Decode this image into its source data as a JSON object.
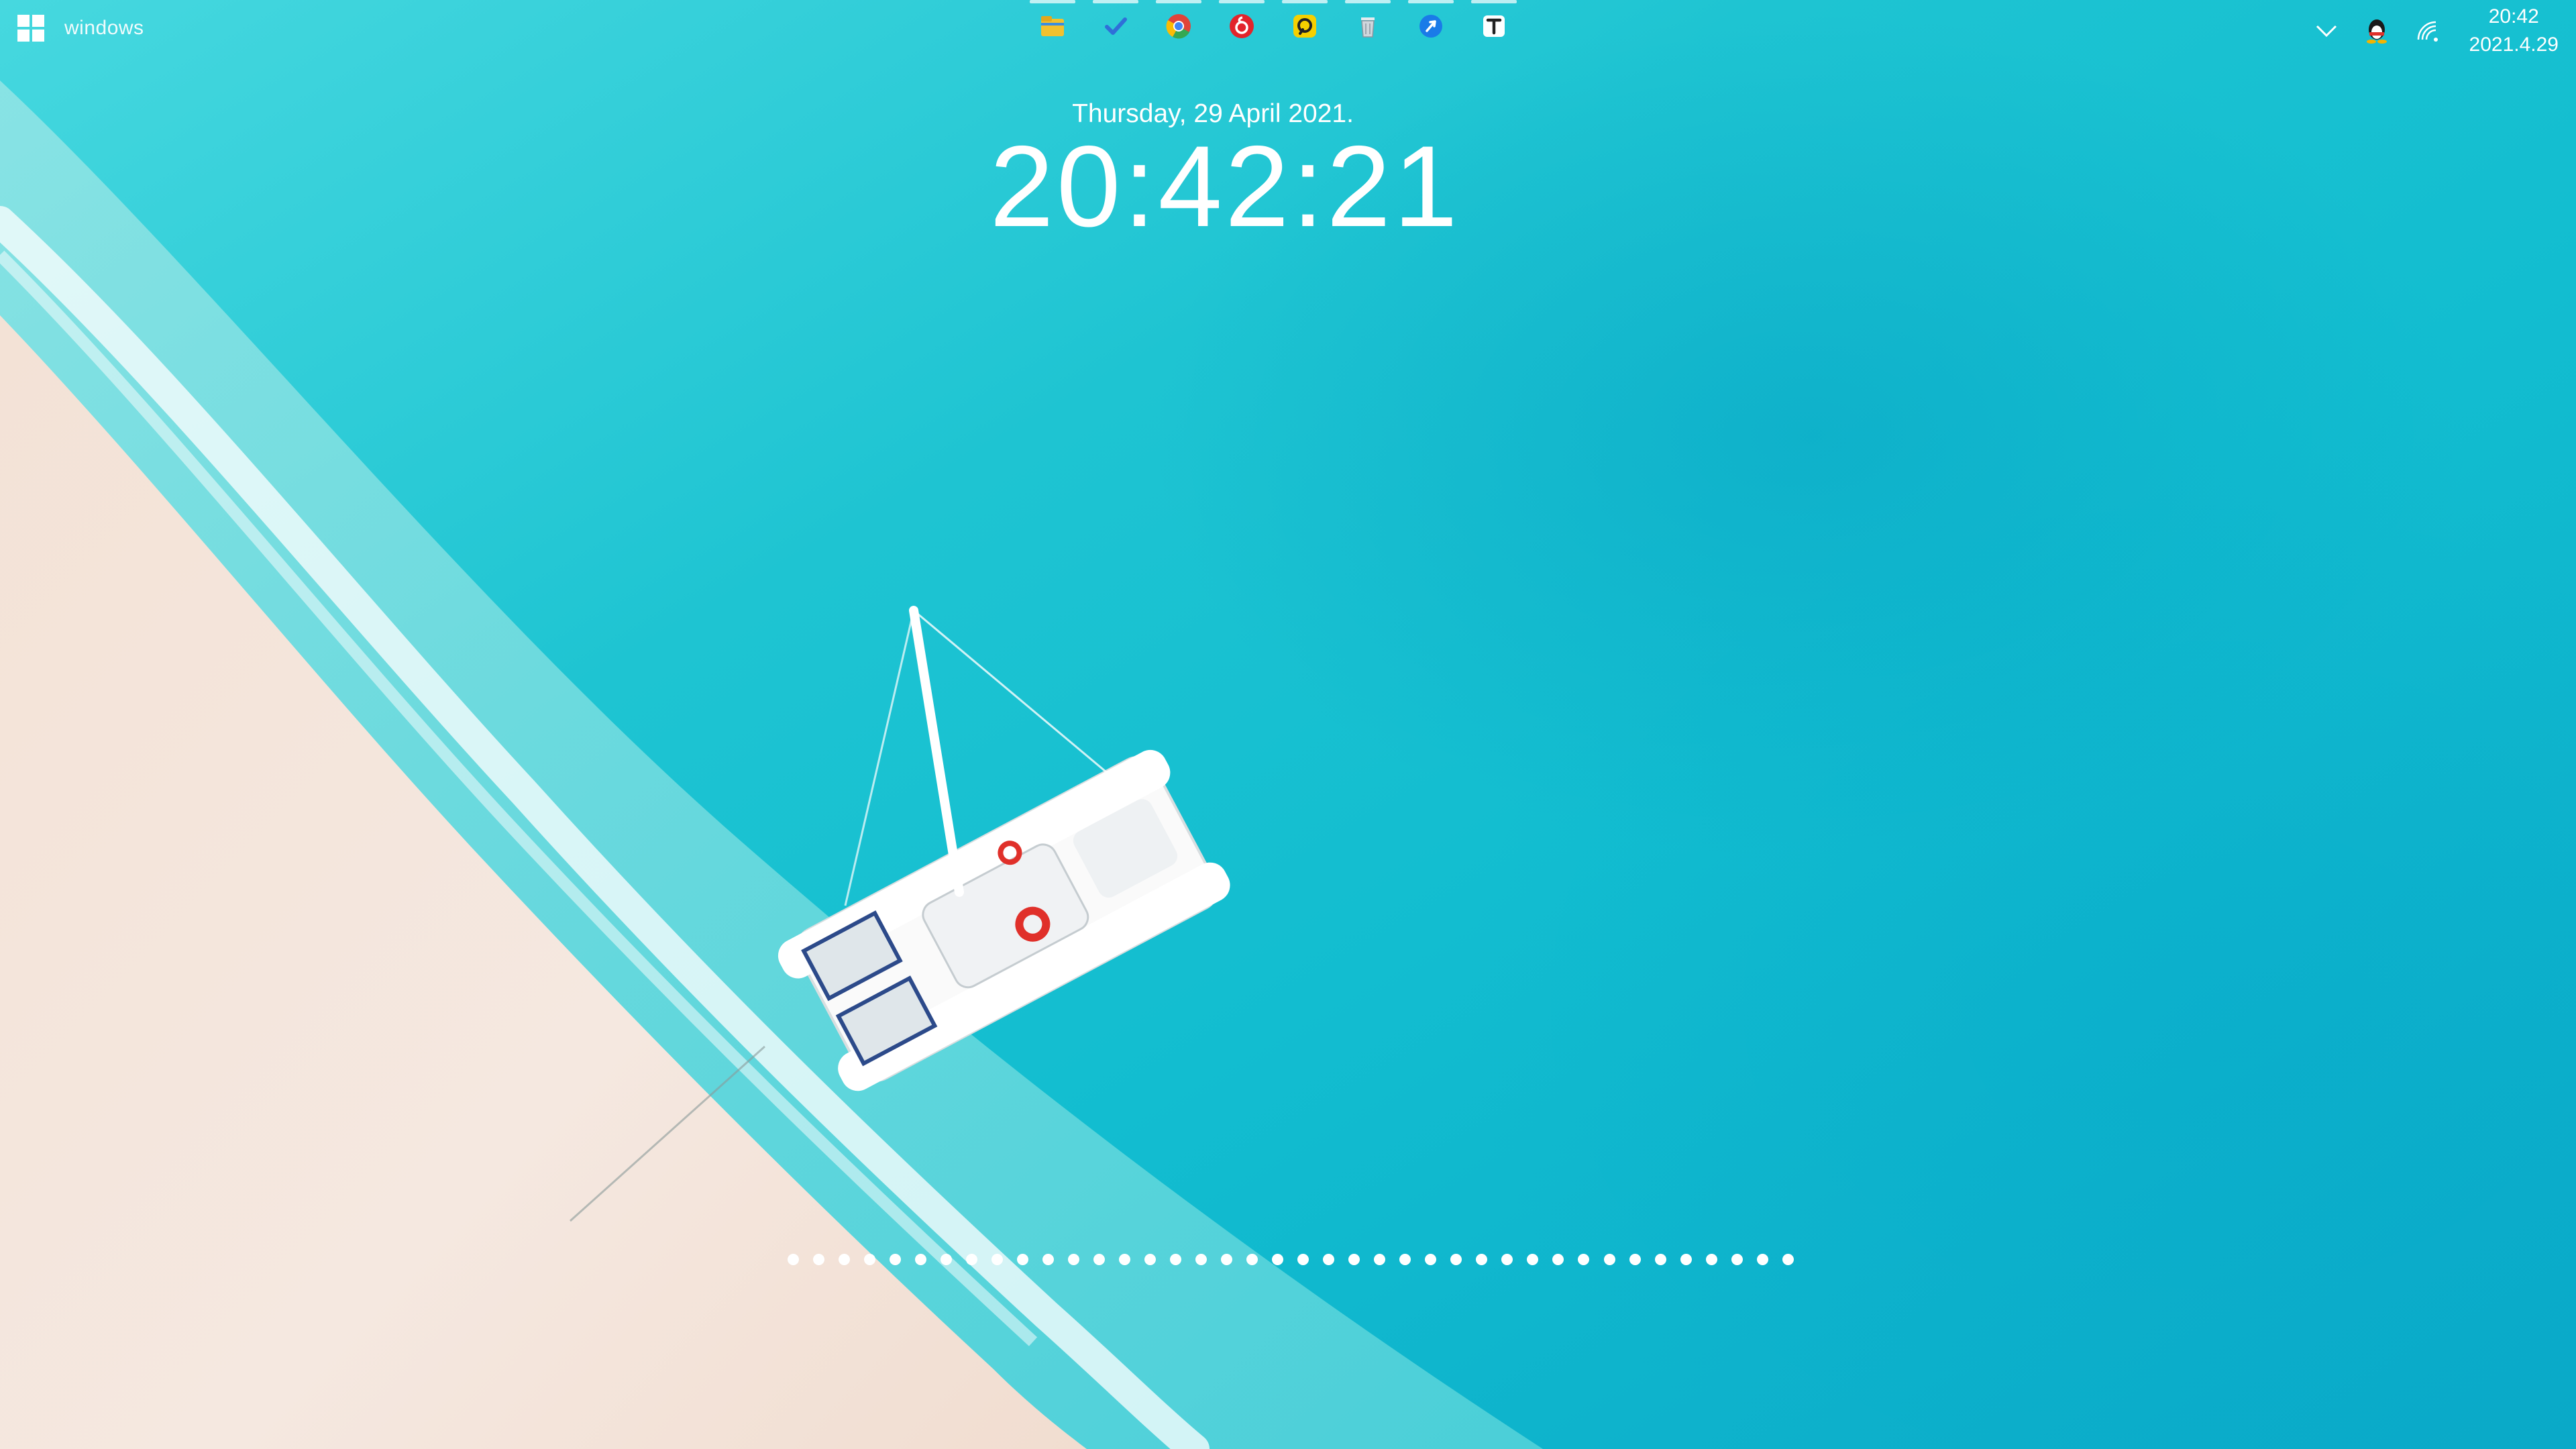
{
  "taskbar": {
    "start_label": "windows",
    "apps": [
      {
        "name": "file-explorer-icon",
        "color": "#f2c12e"
      },
      {
        "name": "todo-check-icon",
        "color": "#3a7be0"
      },
      {
        "name": "chrome-icon",
        "color": "#e0443a"
      },
      {
        "name": "netease-music-icon",
        "color": "#e2242b"
      },
      {
        "name": "yellow-app-icon",
        "color": "#f5d000"
      },
      {
        "name": "recycle-bin-icon",
        "color": "#cfd6dc"
      },
      {
        "name": "blue-dart-icon",
        "color": "#1a7be8"
      },
      {
        "name": "typora-icon",
        "color": "#ffffff"
      }
    ],
    "tray": {
      "clock_time": "20:42",
      "clock_date": "2021.4.29"
    }
  },
  "lock_clock": {
    "date": "Thursday, 29 April 2021.",
    "time": "20:42:21"
  },
  "progress_dots_count": 40,
  "colors": {
    "sea": "#1cc3cf",
    "sand": "#f4e6dc",
    "text": "#ffffff"
  }
}
